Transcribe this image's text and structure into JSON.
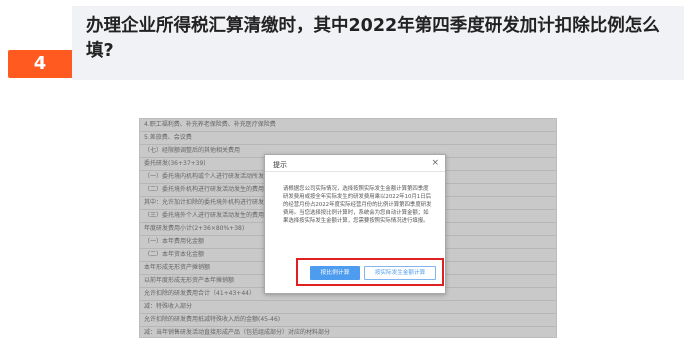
{
  "question": {
    "number": "4",
    "text": "办理企业所得税汇算清缴时，其中2022年第四季度研发加计扣除比例怎么填?"
  },
  "form_rows": [
    "4.职工福利费、补充养老保险费、补充医疗保险费",
    "5.差旅费、会议费",
    "（七）经限额调整后的其他相关费用",
    "委托研发(36+37+39)",
    "（一）委托境内机构或个人进行研发活动所发生的费用",
    "（二）委托境外机构进行研发活动发生的费用",
    "其中：允许加计扣除的委托境外机构进行研发活动发生的费用",
    "（三）委托境外个人进行研发活动发生的费用",
    "年度研发费用小计(2+36×80%+38)",
    "（一）本年费用化金额",
    "（二）本年资本化金额",
    "本年形成无形资产摊销额",
    "以前年度形成无形资产本年摊销额",
    "允许扣除的研发费用合计（41+43+44）",
    "减：特殊收入部分",
    "允许扣除的研发费用抵减特殊收入后的金额(45-46)",
    "减：当年销售研发活动直接形成产品（包括组成部分）对应的材料部分"
  ],
  "dialog": {
    "title": "提示",
    "close_symbol": "×",
    "body": "请根据您公司实际情况，选择按照实际发生金额计算第四季度研发费用或按全年实际发生的研发费用乘以2022年10月1日后的经营月份占2022年度实际经营月份的比例计算第四季度研发费用。当您选择按比例计算时，系统会为您自动计算金额；如果选择按实际发生金额计算，您需要按照实际情况进行填报。",
    "buttons": {
      "by_ratio": "按比例计算",
      "by_actual": "按实际发生金额计算"
    }
  },
  "colors": {
    "badge": "#ff5a1f",
    "question_bg": "#f1f2f5",
    "primary_button": "#4d9cf0",
    "highlight_box": "#e02020"
  }
}
